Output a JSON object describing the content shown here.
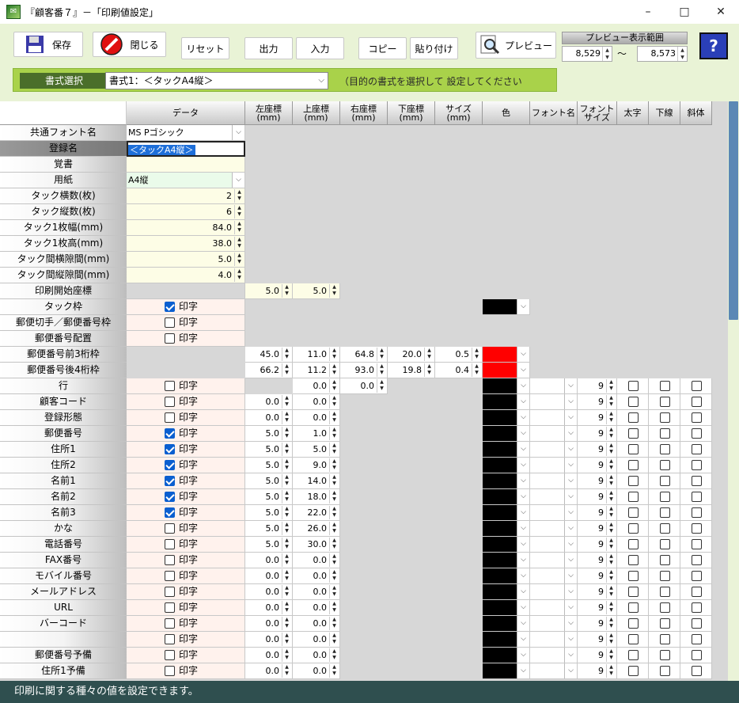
{
  "window": {
    "title": "『顧客番７』－「印刷値設定」",
    "minimize": "–",
    "maximize": "□",
    "close": "✕"
  },
  "toolbar": {
    "save": "保存",
    "close": "閉じる",
    "reset": "リセット",
    "output": "出力",
    "input": "入力",
    "copy": "コピー",
    "paste": "貼り付け",
    "preview": "プレビュー"
  },
  "preview_range": {
    "label": "プレビュー表示範囲",
    "from": "8,529",
    "tilde": "〜",
    "to": "8,573"
  },
  "help": "?",
  "format": {
    "label": "書式選択",
    "selected": "書式1：＜タックA4縦＞",
    "hint": "（目的の書式を選択して 設定してください"
  },
  "headers": [
    "データ",
    "左座標\n(mm)",
    "上座標\n(mm)",
    "右座標\n(mm)",
    "下座標\n(mm)",
    "サイズ\n(mm)",
    "色",
    "フォント名",
    "フォント\nサイズ",
    "太字",
    "下線",
    "斜体"
  ],
  "top_rows": [
    {
      "label": "共通フォント名",
      "data": "MS Pゴシック",
      "type": "select"
    },
    {
      "label": "登録名",
      "data": "＜タックA4縦＞",
      "type": "edit"
    },
    {
      "label": "覚書",
      "data": "",
      "type": "blank"
    },
    {
      "label": "用紙",
      "data": "A4縦",
      "type": "select"
    },
    {
      "label": "タック横数(枚)",
      "data": "2",
      "type": "num"
    },
    {
      "label": "タック縦数(枚)",
      "data": "6",
      "type": "num"
    },
    {
      "label": "タック1枚幅(mm)",
      "data": "84.0",
      "type": "num"
    },
    {
      "label": "タック1枚高(mm)",
      "data": "38.0",
      "type": "num"
    },
    {
      "label": "タック間横隙間(mm)",
      "data": "5.0",
      "type": "num"
    },
    {
      "label": "タック間縦隙間(mm)",
      "data": "4.0",
      "type": "num"
    }
  ],
  "print_start": {
    "label": "印刷開始座標",
    "left": "5.0",
    "top": "5.0"
  },
  "checkbox_label": "印字",
  "tack_frame": {
    "label": "タック枠",
    "checked": true
  },
  "stamp_frame": {
    "label": "郵便切手／郵便番号枠",
    "checked": false
  },
  "zip_place": {
    "label": "郵便番号配置",
    "checked": false
  },
  "zip_rows": [
    {
      "label": "郵便番号前3桁枠",
      "left": "45.0",
      "top": "11.0",
      "right": "64.8",
      "bottom": "20.0",
      "size": "0.5"
    },
    {
      "label": "郵便番号後4桁枠",
      "left": "66.2",
      "top": "11.2",
      "right": "93.0",
      "bottom": "19.8",
      "size": "0.4"
    }
  ],
  "line_row": {
    "label": "行",
    "checked": false,
    "top": "0.0",
    "right": "0.0",
    "font_size": "9"
  },
  "field_rows": [
    {
      "label": "顧客コード",
      "checked": false,
      "left": "0.0",
      "top": "0.0",
      "font_size": "9"
    },
    {
      "label": "登録形態",
      "checked": false,
      "left": "0.0",
      "top": "0.0",
      "font_size": "9"
    },
    {
      "label": "郵便番号",
      "checked": true,
      "left": "5.0",
      "top": "1.0",
      "font_size": "9"
    },
    {
      "label": "住所1",
      "checked": true,
      "left": "5.0",
      "top": "5.0",
      "font_size": "9"
    },
    {
      "label": "住所2",
      "checked": true,
      "left": "5.0",
      "top": "9.0",
      "font_size": "9"
    },
    {
      "label": "名前1",
      "checked": true,
      "left": "5.0",
      "top": "14.0",
      "font_size": "9"
    },
    {
      "label": "名前2",
      "checked": true,
      "left": "5.0",
      "top": "18.0",
      "font_size": "9"
    },
    {
      "label": "名前3",
      "checked": true,
      "left": "5.0",
      "top": "22.0",
      "font_size": "9"
    },
    {
      "label": "かな",
      "checked": false,
      "left": "5.0",
      "top": "26.0",
      "font_size": "9"
    },
    {
      "label": "電話番号",
      "checked": false,
      "left": "5.0",
      "top": "30.0",
      "font_size": "9"
    },
    {
      "label": "FAX番号",
      "checked": false,
      "left": "0.0",
      "top": "0.0",
      "font_size": "9"
    },
    {
      "label": "モバイル番号",
      "checked": false,
      "left": "0.0",
      "top": "0.0",
      "font_size": "9"
    },
    {
      "label": "メールアドレス",
      "checked": false,
      "left": "0.0",
      "top": "0.0",
      "font_size": "9"
    },
    {
      "label": "URL",
      "checked": false,
      "left": "0.0",
      "top": "0.0",
      "font_size": "9"
    },
    {
      "label": "バーコード",
      "checked": false,
      "left": "0.0",
      "top": "0.0",
      "font_size": "9"
    },
    {
      "label": "",
      "checked": false,
      "left": "0.0",
      "top": "0.0",
      "font_size": "9"
    },
    {
      "label": "郵便番号予備",
      "checked": false,
      "left": "0.0",
      "top": "0.0",
      "font_size": "9"
    },
    {
      "label": "住所1予備",
      "checked": false,
      "left": "0.0",
      "top": "0.0",
      "font_size": "9"
    }
  ],
  "colors": {
    "black": "#000000",
    "red": "#ff0000",
    "accent": "#a9d24a"
  },
  "status": "印刷に関する種々の値を設定できます。"
}
